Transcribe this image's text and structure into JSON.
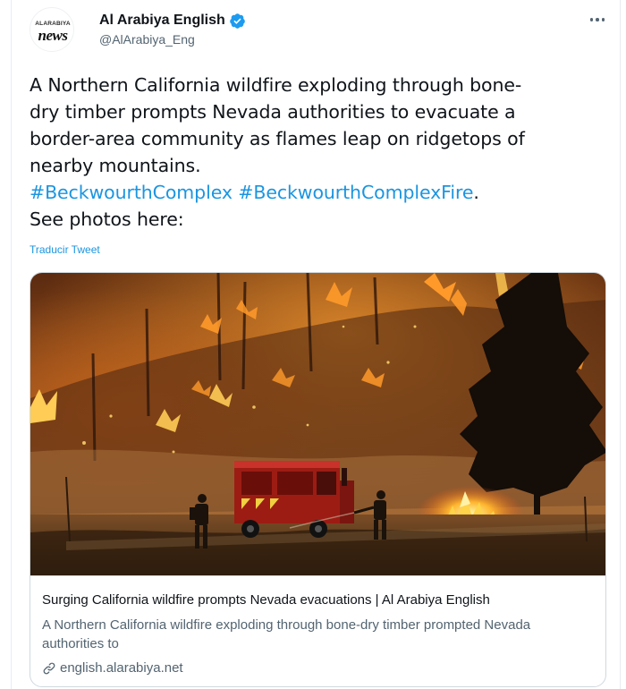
{
  "account": {
    "display_name": "Al Arabiya English",
    "handle": "@AlArabiya_Eng",
    "avatar_text_top": "ALARABIYA",
    "avatar_text_main": "news",
    "verified_icon": "verified-badge-icon"
  },
  "tweet": {
    "text_lines": [
      "A Northern California wildfire exploding through bone-",
      "dry timber prompts Nevada authorities to evacuate a",
      "border-area community as flames leap on ridgetops of",
      "nearby mountains."
    ],
    "hashtags": [
      "#BeckwourthComplex",
      "#BeckwourthComplexFire"
    ],
    "hashtag_separator": " ",
    "hashtag_trailing": ".",
    "closing_line": "See photos here:",
    "translate_label": "Traducir Tweet"
  },
  "link_card": {
    "title": "Surging California wildfire prompts Nevada evacuations | Al Arabiya English",
    "description": "A Northern California wildfire exploding through bone-dry timber prompted Nevada authorities to",
    "domain": "english.alarabiya.net"
  },
  "colors": {
    "link_blue": "#1b95e0",
    "verified_blue": "#1d9bf0",
    "text_primary": "#0f1419",
    "text_secondary": "#536471"
  }
}
